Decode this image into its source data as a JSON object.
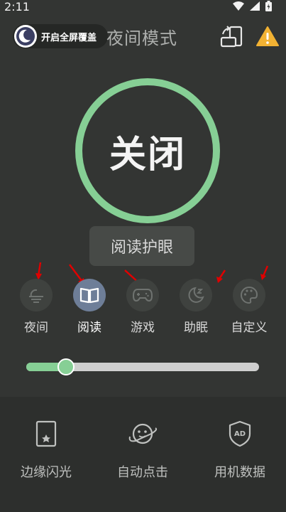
{
  "status": {
    "time": "2:11"
  },
  "header": {
    "chip_label": "开启全屏覆盖",
    "title": "夜间模式"
  },
  "power": {
    "label": "关闭"
  },
  "tooltip": {
    "text": "阅读护眼"
  },
  "modes": [
    {
      "label": "夜间",
      "icon": "sunset-icon",
      "active": false
    },
    {
      "label": "阅读",
      "icon": "book-icon",
      "active": true
    },
    {
      "label": "游戏",
      "icon": "gamepad-icon",
      "active": false
    },
    {
      "label": "助眠",
      "icon": "moon-sleep-icon",
      "active": false
    },
    {
      "label": "自定义",
      "icon": "palette-icon",
      "active": false
    }
  ],
  "slider": {
    "value_percent": 17
  },
  "tools": [
    {
      "label": "边缘闪光",
      "icon": "edge-flash-icon"
    },
    {
      "label": "自动点击",
      "icon": "auto-click-icon"
    },
    {
      "label": "用机数据",
      "icon": "ad-shield-icon"
    }
  ],
  "colors": {
    "accent_green": "#86cf95",
    "background": "#333533",
    "active_mode": "#6e7e98",
    "warning": "#f2b233",
    "arrow": "#e00000"
  }
}
